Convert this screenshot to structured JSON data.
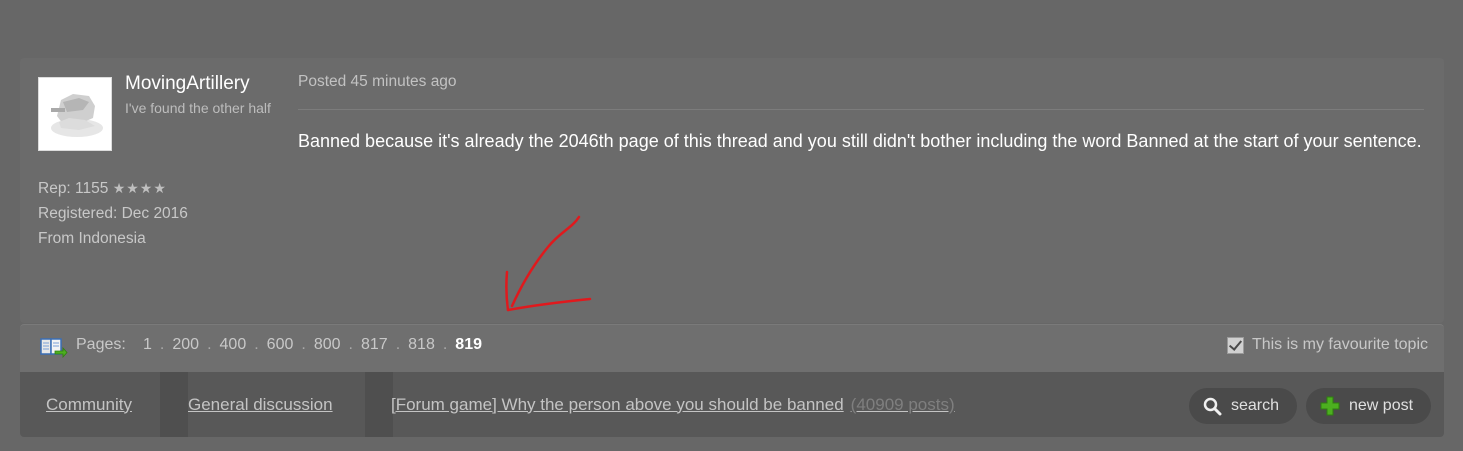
{
  "post": {
    "username": "MovingArtillery",
    "user_title": "I've found the other half",
    "rep_label": "Rep: 1155",
    "rep_stars": "★★★★",
    "registered": "Registered: Dec 2016",
    "location": "From Indonesia",
    "posted": "Posted 45 minutes ago",
    "body": "Banned because it's already the 2046th page of this thread and you still didn't bother including the word Banned at the start of your sentence."
  },
  "pagination": {
    "label": "Pages:",
    "pages": [
      "1",
      "200",
      "400",
      "600",
      "800",
      "817",
      "818",
      "819"
    ],
    "separator": ".",
    "current": "819",
    "favourite_label": "This is my favourite topic",
    "favourite_checked": true
  },
  "breadcrumb": {
    "community": "Community",
    "general": "General discussion",
    "topic": "[Forum game] Why the person above you should be banned",
    "post_count": "(40909 posts)"
  },
  "buttons": {
    "search": "search",
    "new_post": "new post"
  },
  "colors": {
    "background": "#676767",
    "nav_bar": "#585858",
    "annotation": "#e0191d",
    "new_post_icon": "#4caf1f"
  },
  "icons": {
    "avatar": "avatar-image",
    "pages": "book-arrow-icon",
    "search": "magnifier-icon",
    "new_post": "plus-icon",
    "favourite": "checkbox-icon"
  }
}
